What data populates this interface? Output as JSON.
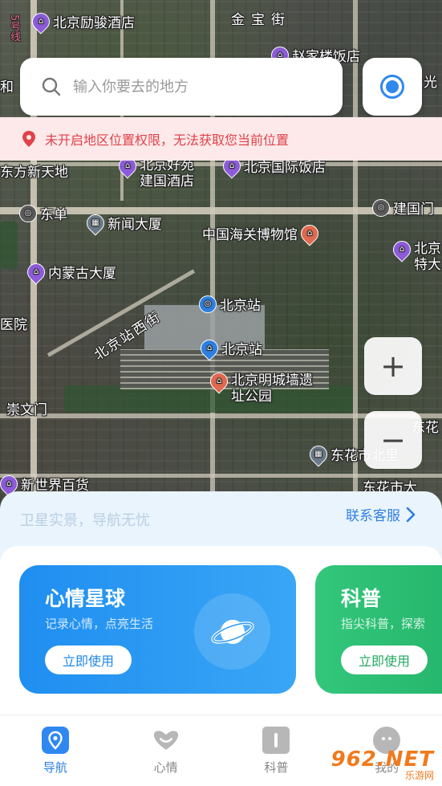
{
  "search": {
    "placeholder": "输入你要去的地方"
  },
  "permission_banner": {
    "text": "未开启地区位置权限，无法获取您当前位置"
  },
  "map": {
    "streets": [
      "金宝街",
      "北京站西街"
    ],
    "places": [
      {
        "label": "北京励骏酒店",
        "type": "hotel"
      },
      {
        "label": "赵家楼饭店",
        "type": "hotel"
      },
      {
        "label": "和",
        "type": "text"
      },
      {
        "label": "光",
        "type": "text"
      },
      {
        "label": "东方新天地",
        "type": "text"
      },
      {
        "label": "北京好苑建国酒店",
        "type": "hotel"
      },
      {
        "label": "北京国际饭店",
        "type": "hotel"
      },
      {
        "label": "东单",
        "type": "metro"
      },
      {
        "label": "新闻大厦",
        "type": "station"
      },
      {
        "label": "建国门",
        "type": "metro"
      },
      {
        "label": "中国海关博物馆",
        "type": "museum"
      },
      {
        "label": "北京特大",
        "type": "hotel"
      },
      {
        "label": "内蒙古大厦",
        "type": "hotel"
      },
      {
        "label": "北京站",
        "type": "metro"
      },
      {
        "label": "医院",
        "type": "text"
      },
      {
        "label": "北京站",
        "type": "station"
      },
      {
        "label": "北京明城墙遗址公园",
        "type": "museum"
      },
      {
        "label": "崇文门",
        "type": "text"
      },
      {
        "label": "东花市北里",
        "type": "station"
      },
      {
        "label": "东花",
        "type": "text"
      },
      {
        "label": "新世界百货",
        "type": "shop"
      },
      {
        "label": "东花市大",
        "type": "text"
      }
    ],
    "left_edge": "5号线",
    "zoom_in": "+",
    "zoom_out": "−"
  },
  "panel": {
    "slogan": "卫星实景，导航无忧",
    "contact": "联系客服",
    "cards": [
      {
        "title": "心情星球",
        "subtitle": "记录心情，点亮生活",
        "button": "立即使用"
      },
      {
        "title": "科普",
        "subtitle": "指尖科普，探索",
        "button": "立即使用"
      }
    ]
  },
  "bottom_nav": [
    {
      "label": "导航",
      "active": true
    },
    {
      "label": "心情",
      "active": false
    },
    {
      "label": "科普",
      "active": false
    },
    {
      "label": "我的",
      "active": false
    }
  ],
  "watermark": {
    "main": "962.NET",
    "sub": "乐游网"
  },
  "colors": {
    "accent": "#2f7fe0",
    "banner_text": "#e0424a",
    "green_card": "#33c77b"
  }
}
